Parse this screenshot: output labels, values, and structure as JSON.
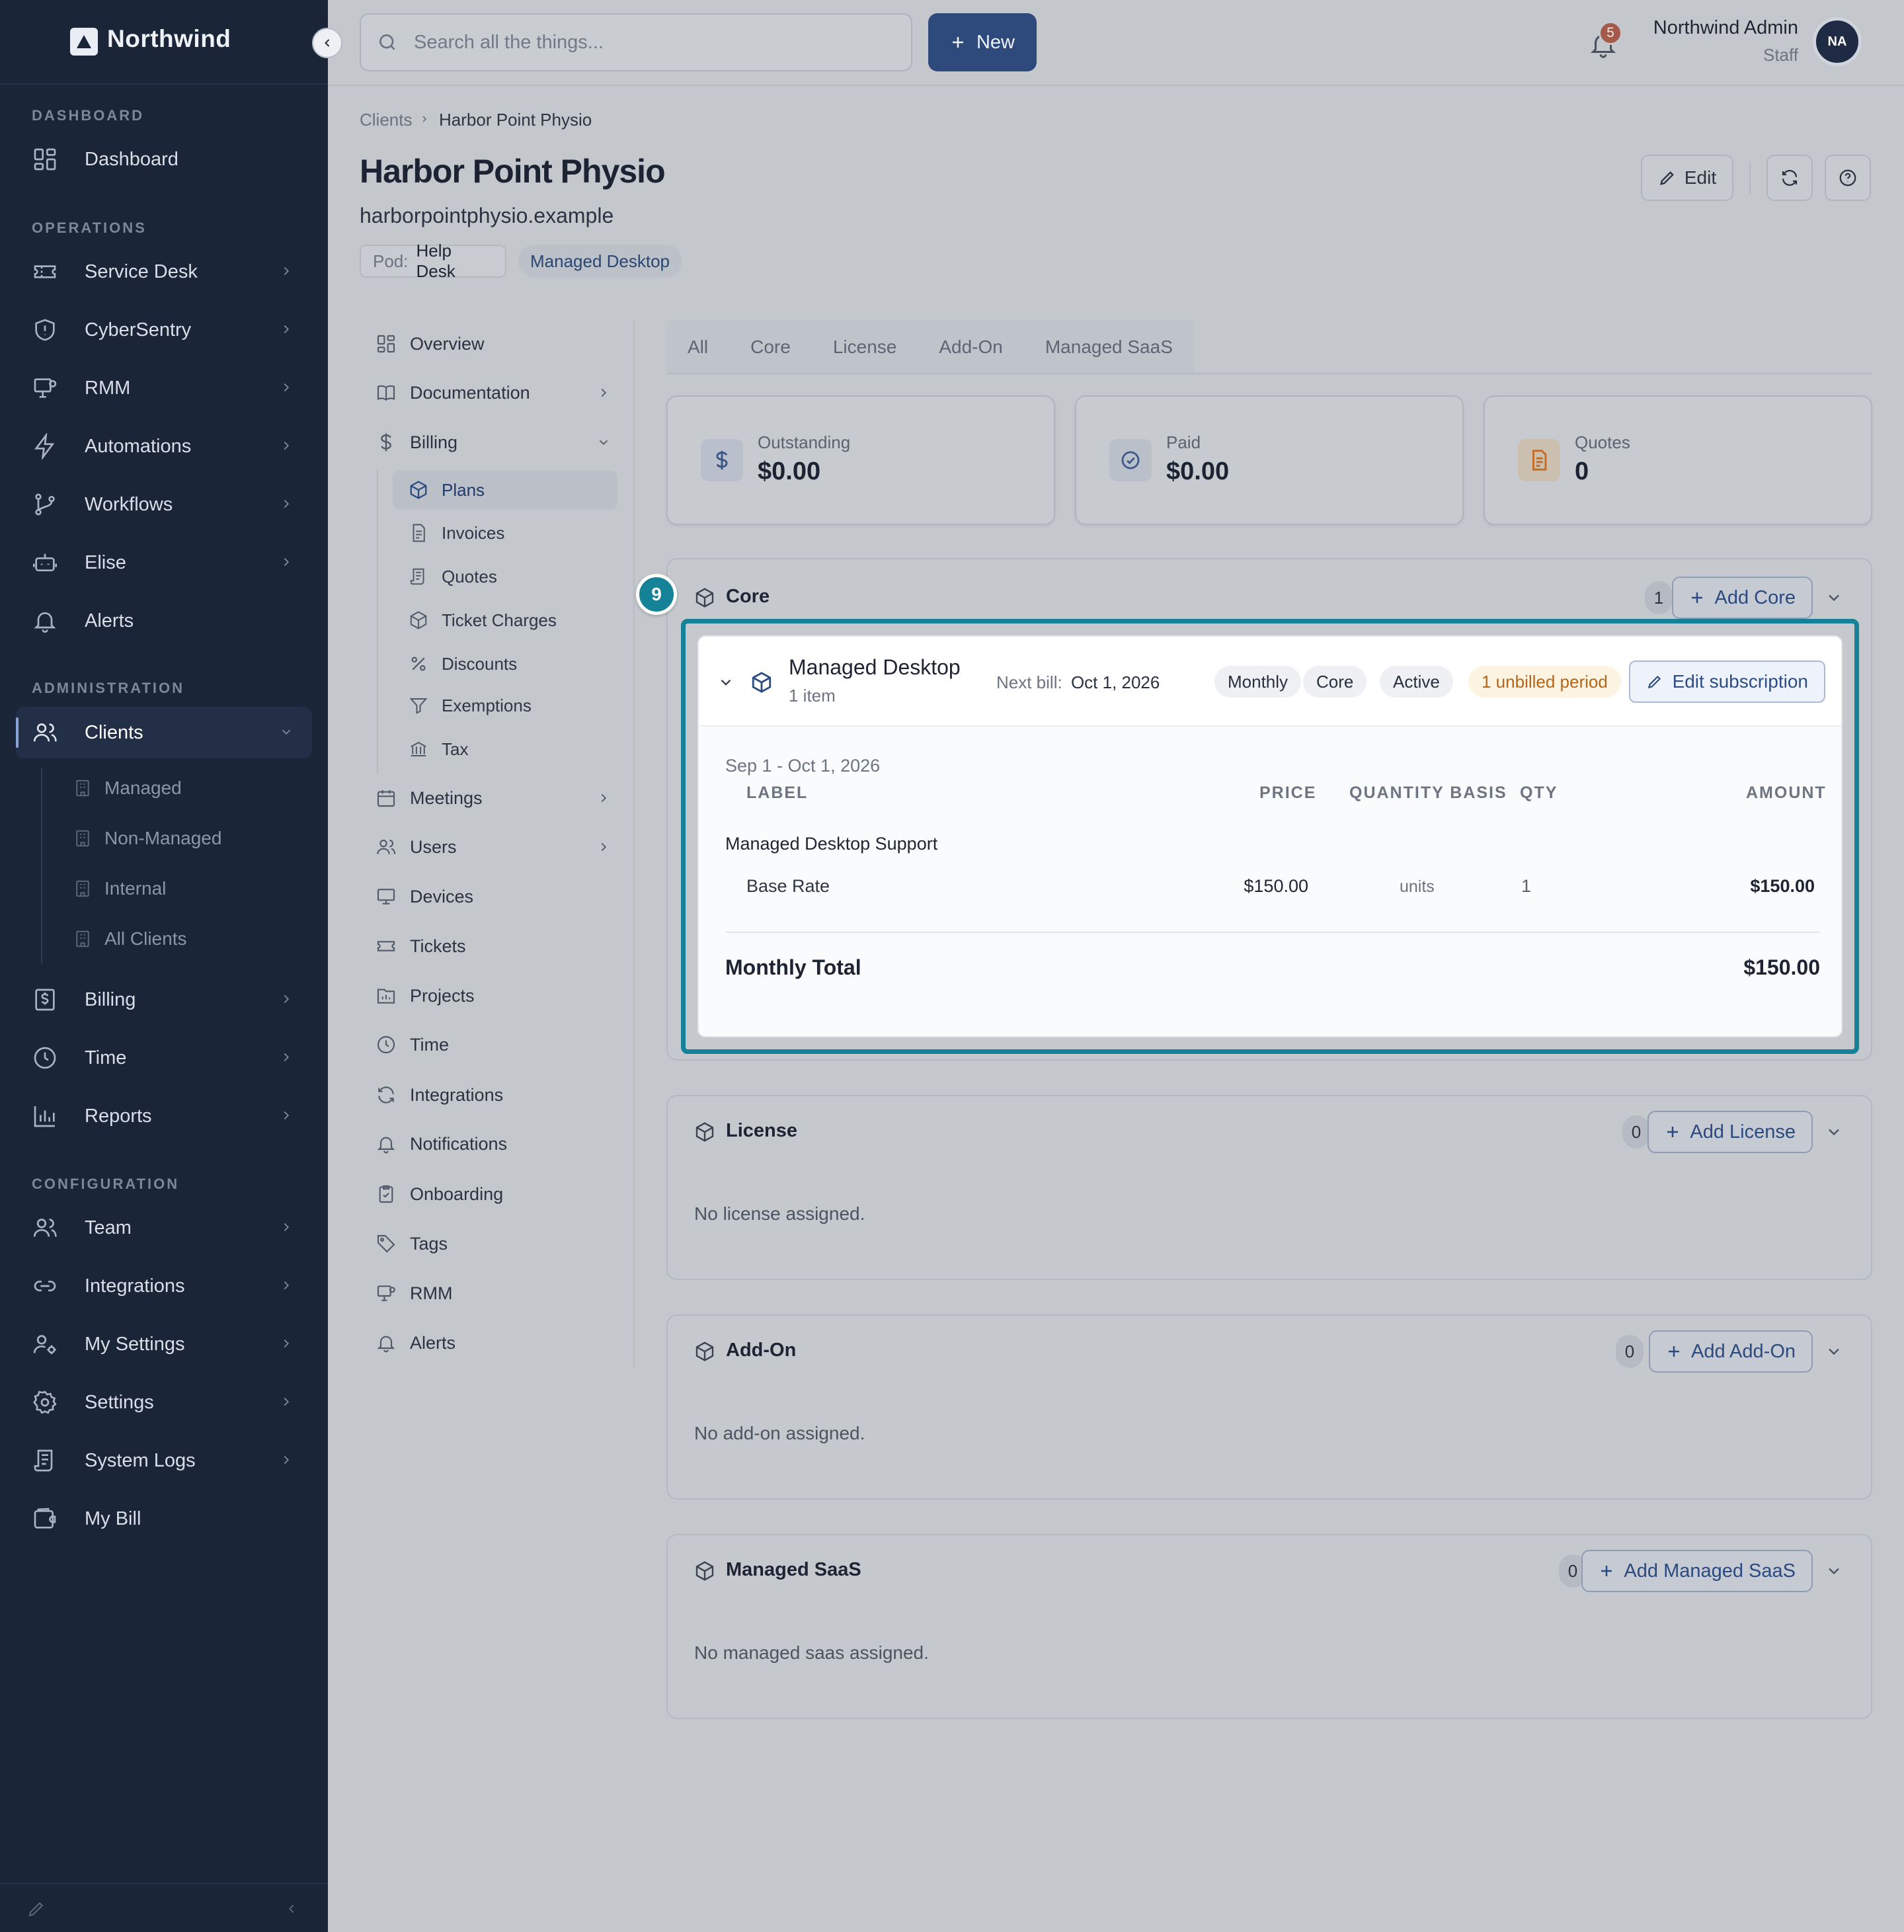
{
  "brand": {
    "name": "Northwind"
  },
  "sidebar": {
    "sections": {
      "dashboard": "DASHBOARD",
      "operations": "OPERATIONS",
      "administration": "ADMINISTRATION",
      "configuration": "CONFIGURATION"
    },
    "items": {
      "dashboard": "Dashboard",
      "service_desk": "Service Desk",
      "cybersentry": "CyberSentry",
      "rmm": "RMM",
      "automations": "Automations",
      "workflows": "Workflows",
      "elise": "Elise",
      "alerts": "Alerts",
      "clients": "Clients",
      "billing": "Billing",
      "time": "Time",
      "reports": "Reports",
      "team": "Team",
      "integrations": "Integrations",
      "my_settings": "My Settings",
      "settings": "Settings",
      "system_logs": "System Logs",
      "my_bill": "My Bill"
    },
    "clients_sub": {
      "managed": "Managed",
      "non_managed": "Non-Managed",
      "internal": "Internal",
      "all_clients": "All Clients"
    }
  },
  "topbar": {
    "search_placeholder": "Search all the things...",
    "new_label": "New",
    "notifications_count": "5",
    "user_name": "Northwind Admin",
    "user_role": "Staff",
    "avatar_initials": "NA"
  },
  "breadcrumb": {
    "parent": "Clients",
    "current": "Harbor Point Physio"
  },
  "client": {
    "name": "Harbor Point Physio",
    "domain": "harborpointphysio.example",
    "pod_label": "Pod:",
    "pod_value": "Help Desk",
    "plan_chip": "Managed Desktop"
  },
  "header_actions": {
    "edit": "Edit"
  },
  "subnav": {
    "overview": "Overview",
    "documentation": "Documentation",
    "billing": "Billing",
    "billing_sub": {
      "plans": "Plans",
      "invoices": "Invoices",
      "quotes": "Quotes",
      "ticket_charges": "Ticket Charges",
      "discounts": "Discounts",
      "exemptions": "Exemptions",
      "tax": "Tax"
    },
    "meetings": "Meetings",
    "users": "Users",
    "devices": "Devices",
    "tickets": "Tickets",
    "projects": "Projects",
    "time": "Time",
    "integrations": "Integrations",
    "notifications": "Notifications",
    "onboarding": "Onboarding",
    "tags": "Tags",
    "rmm": "RMM",
    "alerts": "Alerts"
  },
  "tabs": [
    "All",
    "Core",
    "License",
    "Add-On",
    "Managed SaaS"
  ],
  "stats": {
    "outstanding": {
      "label": "Outstanding",
      "value": "$0.00"
    },
    "paid": {
      "label": "Paid",
      "value": "$0.00"
    },
    "quotes": {
      "label": "Quotes",
      "value": "0"
    }
  },
  "step_badge": "9",
  "core": {
    "title": "Core",
    "count": "1",
    "add_label": "Add Core",
    "subscription": {
      "name": "Managed Desktop",
      "items": "1 item",
      "next_bill_label": "Next bill:",
      "next_bill_date": "Oct 1, 2026",
      "pills": [
        "Monthly",
        "Core",
        "Active"
      ],
      "warning": "1 unbilled period",
      "edit_label": "Edit subscription",
      "period": "Sep 1 - Oct 1, 2026",
      "columns": {
        "label": "LABEL",
        "price": "PRICE",
        "basis": "QUANTITY BASIS",
        "qty": "QTY",
        "amount": "AMOUNT"
      },
      "group": "Managed Desktop Support",
      "line": {
        "label": "Base Rate",
        "price": "$150.00",
        "basis": "units",
        "qty": "1",
        "amount": "$150.00"
      },
      "total_label": "Monthly Total",
      "total_value": "$150.00"
    }
  },
  "license": {
    "title": "License",
    "count": "0",
    "add_label": "Add License",
    "empty": "No license assigned."
  },
  "addon": {
    "title": "Add-On",
    "count": "0",
    "add_label": "Add Add-On",
    "empty": "No add-on assigned."
  },
  "saas": {
    "title": "Managed SaaS",
    "count": "0",
    "add_label": "Add Managed SaaS",
    "empty": "No managed saas assigned."
  }
}
